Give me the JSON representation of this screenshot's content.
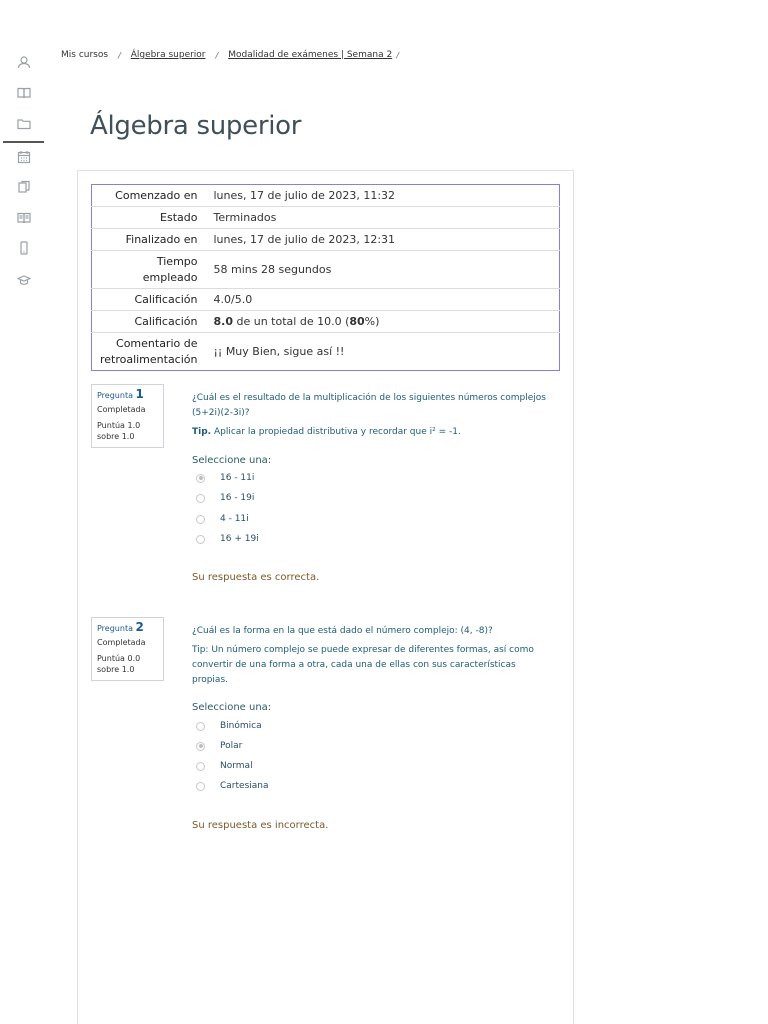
{
  "breadcrumb": [
    {
      "label": "Mis cursos",
      "link": false
    },
    {
      "label": "Álgebra superior",
      "link": true
    },
    {
      "label": "Modalidad de exámenes | Semana 2",
      "link": true
    }
  ],
  "breadcrumb_sep": "/",
  "page_title": "Álgebra superior",
  "rail_icons": [
    "user-icon",
    "book-icon",
    "folder-icon",
    "calendar-icon",
    "files-icon",
    "book-open-icon",
    "mobile-icon",
    "graduation-cap-icon"
  ],
  "summary": {
    "started_label": "Comenzado en",
    "started_value": "lunes, 17 de julio de 2023, 11:32",
    "state_label": "Estado",
    "state_value": "Terminados",
    "finished_label": "Finalizado en",
    "finished_value": "lunes, 17 de julio de 2023, 12:31",
    "time_label_1": "Tiempo",
    "time_label_2": "empleado",
    "time_value": "58 mins 28 segundos",
    "marks_label": "Calificación",
    "marks_value": "4.0/5.0",
    "grade_label": "Calificación",
    "grade_value_bold": "8.0",
    "grade_value_mid": " de un total de 10.0 (",
    "grade_value_pct": "80",
    "grade_value_end": "%)",
    "feedback_label_1": "Comentario de",
    "feedback_label_2": "retroalimentación",
    "feedback_value": "¡¡ Muy Bien, sigue así !!"
  },
  "questions": [
    {
      "label": "Pregunta",
      "number": "1",
      "state": "Completada",
      "grade_1": "Puntúa 1.0",
      "grade_2": "sobre 1.0",
      "text_1": "¿Cuál es el resultado de la multiplicación de los siguientes números complejos",
      "text_2": "(5+2i)(2-3i)?",
      "tip_bold": "Tip.",
      "tip_text": " Aplicar la propiedad distributiva y recordar que i² = -1.",
      "prompt": "Seleccione una:",
      "options": [
        "16 - 11i",
        "16 - 19i",
        "4 - 11i",
        "16 + 19i"
      ],
      "selected_index": 0,
      "feedback": "Su respuesta es correcta."
    },
    {
      "label": "Pregunta",
      "number": "2",
      "state": "Completada",
      "grade_1": "Puntúa 0.0",
      "grade_2": "sobre 1.0",
      "text_1": "¿Cuál es la forma en la que está dado el número complejo: (4, -8)?",
      "tip_line_1": "Tip: Un número complejo se puede expresar de diferentes formas, así como",
      "tip_line_2": "convertir de una forma a otra, cada una de ellas con sus características",
      "tip_line_3": "propias.",
      "prompt": "Seleccione una:",
      "options": [
        "Binómica",
        "Polar",
        "Normal",
        "Cartesiana"
      ],
      "selected_index": 1,
      "feedback": "Su respuesta es incorrecta."
    }
  ]
}
